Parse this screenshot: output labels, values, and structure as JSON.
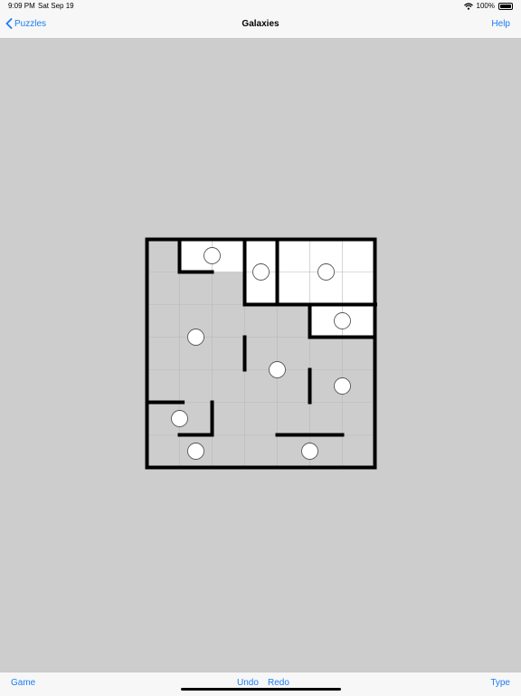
{
  "status": {
    "time": "9:09 PM",
    "date": "Sat Sep 19",
    "battery": "100%"
  },
  "nav": {
    "back_label": "Puzzles",
    "title": "Galaxies",
    "help_label": "Help"
  },
  "toolbar": {
    "game_label": "Game",
    "undo_label": "Undo",
    "redo_label": "Redo",
    "type_label": "Type"
  },
  "colors": {
    "accent": "#1a7cf5",
    "background": "#cdcdcd",
    "filled_region": "#ffffff",
    "wall": "#000000",
    "grid": "#b9b9b9"
  },
  "puzzle": {
    "size": 7,
    "filled_cells": [
      [
        1,
        0
      ],
      [
        2,
        0
      ],
      [
        3,
        0
      ],
      [
        3,
        1
      ],
      [
        4,
        0
      ],
      [
        5,
        0
      ],
      [
        6,
        0
      ],
      [
        4,
        1
      ],
      [
        5,
        1
      ],
      [
        6,
        1
      ],
      [
        5,
        2
      ],
      [
        6,
        2
      ]
    ],
    "walls": [
      [
        "v",
        1,
        0,
        1
      ],
      [
        "h",
        1,
        1,
        2
      ],
      [
        "v",
        3,
        0,
        2
      ],
      [
        "h",
        3,
        2,
        9
      ],
      [
        "v",
        4,
        0,
        2
      ],
      [
        "v",
        5,
        2,
        3
      ],
      [
        "h",
        5,
        3,
        7
      ],
      [
        "h",
        0,
        5,
        1.1
      ],
      [
        "h",
        1,
        6,
        2
      ],
      [
        "v",
        2,
        5,
        6
      ],
      [
        "v",
        3,
        3,
        4
      ],
      [
        "v",
        5,
        4,
        5
      ],
      [
        "h",
        4,
        6,
        6
      ]
    ],
    "dots": [
      [
        2,
        0.5
      ],
      [
        3.5,
        1
      ],
      [
        5.5,
        1
      ],
      [
        6,
        2.5
      ],
      [
        1.5,
        3
      ],
      [
        4,
        4
      ],
      [
        6,
        4.5
      ],
      [
        1,
        5.5
      ],
      [
        1.5,
        6.5
      ],
      [
        5,
        6.5
      ]
    ]
  }
}
